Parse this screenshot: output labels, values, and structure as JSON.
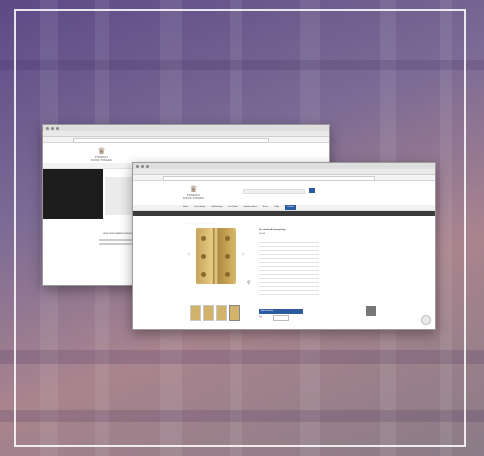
{
  "page": {
    "tagline": "HIGH PERFORMANCE HINGES"
  },
  "back_window": {
    "brand": "PHOENIX",
    "sub": "DOOR HINGES"
  },
  "front_window": {
    "brand": "PHOENIX",
    "sub": "DOOR HINGES",
    "nav": [
      "Home",
      "Door Hinges",
      "Ball Bearing",
      "Fire Rated",
      "Stainless Steel",
      "Brass",
      "Trade",
      "Contact"
    ],
    "breadcrumb": "Home / Fire Rated Ball Bearing Hinge",
    "product_title": "Fire rated ball bearing hinge",
    "price": "£00.00",
    "add_to_basket": "Add to basket",
    "qty_label": "Qty"
  }
}
